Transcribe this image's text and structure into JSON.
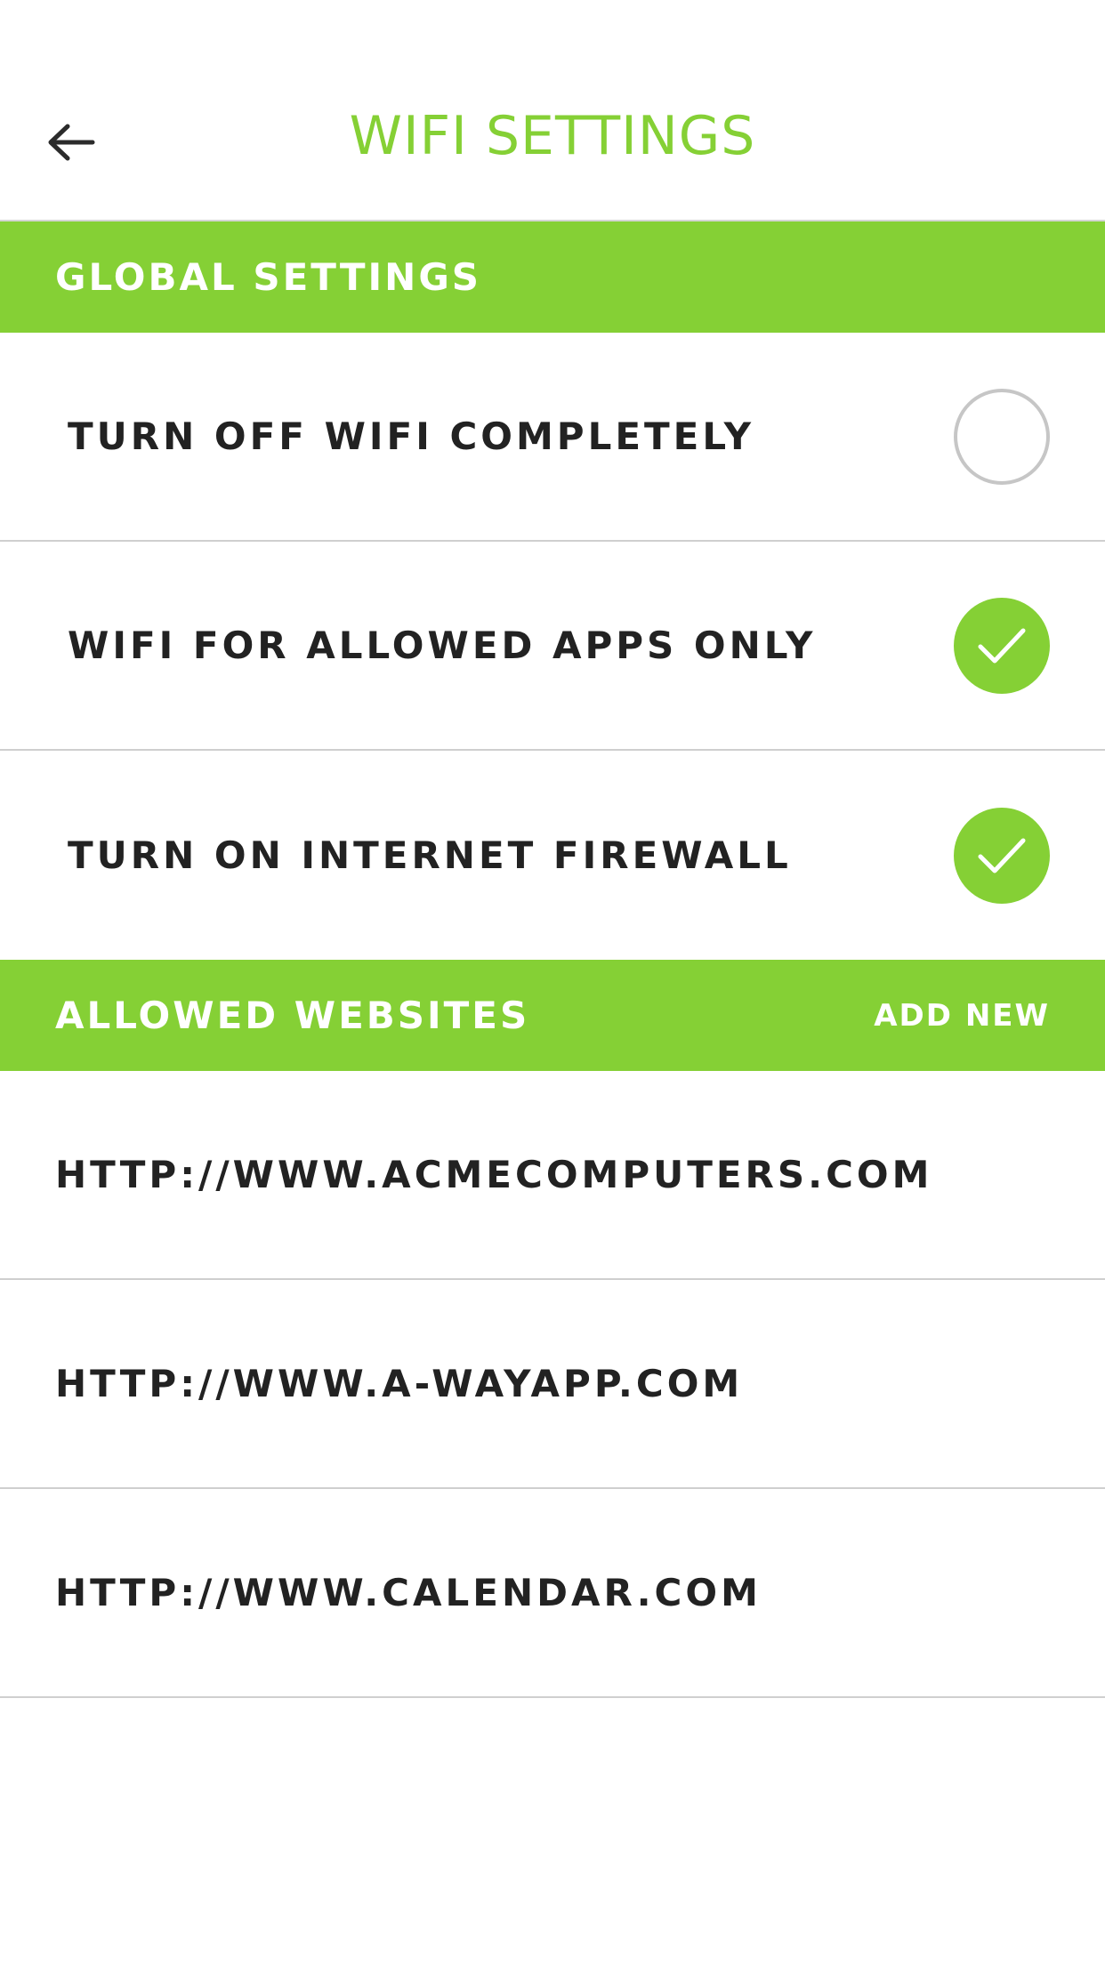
{
  "header": {
    "title": "WIFI SETTINGS",
    "back_icon": "arrow-left-icon"
  },
  "global_settings": {
    "title": "GLOBAL SETTINGS",
    "items": [
      {
        "label": "TURN OFF WIFI COMPLETELY",
        "checked": false
      },
      {
        "label": "WIFI FOR ALLOWED APPS ONLY",
        "checked": true
      },
      {
        "label": "TURN ON INTERNET FIREWALL",
        "checked": true
      }
    ]
  },
  "allowed_websites": {
    "title": "ALLOWED WEBSITES",
    "add_label": "ADD NEW",
    "items": [
      "HTTP://WWW.ACMECOMPUTERS.COM",
      "HTTP://WWW.A-WAYAPP.COM",
      "HTTP://WWW.CALENDAR.COM"
    ]
  },
  "colors": {
    "accent": "#85d035",
    "text": "#222222",
    "divider": "#cfcfcf"
  }
}
